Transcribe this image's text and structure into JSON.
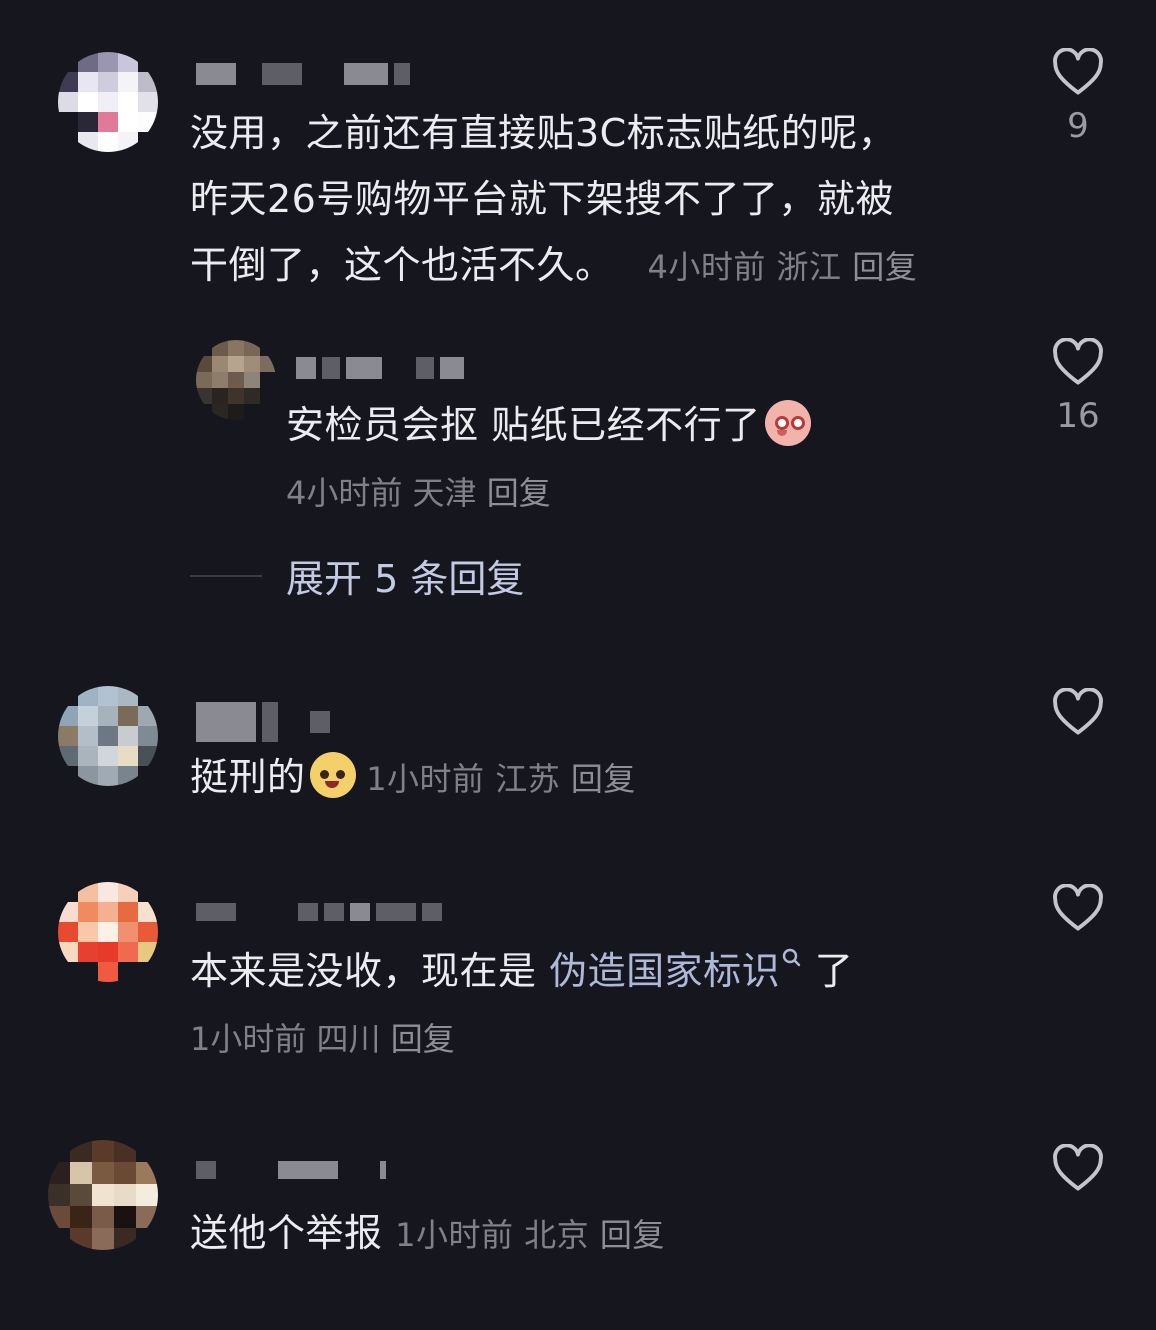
{
  "comments": [
    {
      "text": "没用，之前还有直接贴3C标志贴纸的呢，昨天26号购物平台就下架搜不了了，就被干倒了，这个也活不久。",
      "line1": "没用，之前还有直接贴3C标志贴纸的呢，",
      "line2": "昨天26号购物平台就下架搜不了了，就被",
      "line3": "干倒了，这个也活不久。",
      "time": "4小时前",
      "location": "浙江",
      "reply": "回复",
      "likes": "9"
    },
    {
      "text": "安检员会抠 贴纸已经不行了",
      "time": "4小时前",
      "location": "天津",
      "reply": "回复",
      "likes": "16"
    },
    {
      "text": "挺刑的",
      "time": "1小时前",
      "location": "江苏",
      "reply": "回复",
      "likes": ""
    },
    {
      "text_before": "本来是没收，现在是 ",
      "link": "伪造国家标识",
      "text_after": " 了",
      "time": "1小时前",
      "location": "四川",
      "reply": "回复",
      "likes": ""
    },
    {
      "text": "送他个举报",
      "time": "1小时前",
      "location": "北京",
      "reply": "回复",
      "likes": ""
    }
  ],
  "expand_replies": "展开 5 条回复",
  "colors": {
    "background": "#16161e",
    "text": "#ececf0",
    "meta": "#80808a",
    "link": "#aeb8d8"
  }
}
